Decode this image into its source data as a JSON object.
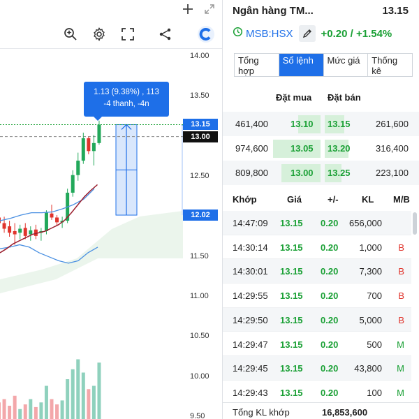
{
  "chart": {
    "tooltip_line1": "1.13 (9.38%) , 113",
    "tooltip_line2": "-4 thanh, -4n",
    "y_ticks": [
      "14.00",
      "13.50",
      "12.50",
      "11.50",
      "11.00",
      "10.50",
      "10.00",
      "9.50"
    ],
    "y_tick_values": [
      14.0,
      13.5,
      12.5,
      11.5,
      11.0,
      10.5,
      10.0,
      9.5
    ],
    "badge_current": "13.15",
    "badge_current_value": 13.15,
    "badge_prev": "13.00",
    "badge_prev_value": 13.0,
    "badge_low": "12.02",
    "badge_low_value": 12.02,
    "icons": [
      "plus-icon",
      "expand-icon",
      "magic-search-icon",
      "gear-icon",
      "fullscreen-icon",
      "share-icon",
      "brand-logo-icon"
    ]
  },
  "chart_data": {
    "type": "candlestick",
    "ylim": [
      9.4,
      14.1
    ],
    "candles": [
      {
        "o": 11.99,
        "h": 12.05,
        "l": 11.85,
        "c": 11.92
      },
      {
        "o": 11.92,
        "h": 12.0,
        "l": 11.8,
        "c": 11.85
      },
      {
        "o": 11.88,
        "h": 11.95,
        "l": 11.75,
        "c": 11.8
      },
      {
        "o": 11.82,
        "h": 11.92,
        "l": 11.65,
        "c": 11.78
      },
      {
        "o": 11.8,
        "h": 11.9,
        "l": 11.72,
        "c": 11.85
      },
      {
        "o": 11.86,
        "h": 11.92,
        "l": 11.72,
        "c": 11.76
      },
      {
        "o": 11.78,
        "h": 11.88,
        "l": 11.7,
        "c": 11.83
      },
      {
        "o": 11.84,
        "h": 11.9,
        "l": 11.72,
        "c": 11.76
      },
      {
        "o": 11.8,
        "h": 11.86,
        "l": 11.7,
        "c": 11.82
      },
      {
        "o": 11.82,
        "h": 12.08,
        "l": 11.78,
        "c": 12.05
      },
      {
        "o": 12.04,
        "h": 12.15,
        "l": 11.96,
        "c": 11.99
      },
      {
        "o": 11.99,
        "h": 12.02,
        "l": 11.88,
        "c": 11.93
      },
      {
        "o": 11.93,
        "h": 12.0,
        "l": 11.86,
        "c": 11.95
      },
      {
        "o": 11.95,
        "h": 12.35,
        "l": 11.92,
        "c": 12.3
      },
      {
        "o": 12.3,
        "h": 12.58,
        "l": 12.25,
        "c": 12.52
      },
      {
        "o": 12.52,
        "h": 12.8,
        "l": 12.45,
        "c": 12.7
      },
      {
        "o": 12.7,
        "h": 13.05,
        "l": 12.66,
        "c": 12.98
      },
      {
        "o": 12.98,
        "h": 13.0,
        "l": 12.78,
        "c": 12.82
      },
      {
        "o": 12.82,
        "h": 13.02,
        "l": 12.64,
        "c": 12.92
      },
      {
        "o": 12.92,
        "h": 13.2,
        "l": 12.9,
        "c": 13.15
      }
    ],
    "bollinger_upper": [
      11.95,
      11.98,
      12.02,
      12.05,
      12.05,
      12.06,
      12.1,
      12.15,
      12.22,
      12.35
    ],
    "bollinger_lower": [
      11.6,
      11.62,
      11.65,
      11.62,
      11.55,
      11.5,
      11.45,
      11.42,
      11.45,
      11.55,
      11.62
    ],
    "ma_line": [
      11.55,
      11.6,
      11.66,
      11.7,
      11.74,
      11.78,
      11.8,
      11.82,
      11.86,
      11.9,
      11.96,
      12.05,
      12.15,
      12.25,
      12.33,
      12.4
    ],
    "volume": [
      0.25,
      0.3,
      0.2,
      0.35,
      0.15,
      0.22,
      0.3,
      0.18,
      0.25,
      0.5,
      0.3,
      0.22,
      0.28,
      0.6,
      0.75,
      0.9,
      0.7,
      0.45,
      0.5,
      0.85
    ]
  },
  "panel": {
    "ticker_name": "Ngân hàng TM...",
    "ticker_price": "13.15",
    "symbol": "MSB:HSX",
    "change": "+0.20 / +1.54%",
    "tabs": [
      {
        "label": "Tổng hợp",
        "active": false
      },
      {
        "label": "Sổ lệnh",
        "active": true
      },
      {
        "label": "Mức giá",
        "active": false
      },
      {
        "label": "Thống kê",
        "active": false
      }
    ],
    "book_header": {
      "buy": "Đặt mua",
      "sell": "Đặt bán"
    },
    "book": [
      {
        "buy_vol": "461,400",
        "buy_px": "13.10",
        "sell_px": "13.15",
        "sell_vol": "261,600",
        "buy_frac": 0.4,
        "sell_frac": 0.35
      },
      {
        "buy_vol": "974,600",
        "buy_px": "13.05",
        "sell_px": "13.20",
        "sell_vol": "316,400",
        "buy_frac": 0.85,
        "sell_frac": 0.42
      },
      {
        "buy_vol": "809,800",
        "buy_px": "13.00",
        "sell_px": "13.25",
        "sell_vol": "223,100",
        "buy_frac": 0.7,
        "sell_frac": 0.3
      }
    ],
    "trades_header": {
      "time": "Khớp",
      "price": "Giá",
      "change": "+/-",
      "volume": "KL",
      "side": "M/B"
    },
    "trades": [
      {
        "time": "14:47:09",
        "price": "13.15",
        "change": "0.20",
        "volume": "656,000",
        "side": ""
      },
      {
        "time": "14:30:14",
        "price": "13.15",
        "change": "0.20",
        "volume": "1,000",
        "side": "B"
      },
      {
        "time": "14:30:01",
        "price": "13.15",
        "change": "0.20",
        "volume": "7,300",
        "side": "B"
      },
      {
        "time": "14:29:55",
        "price": "13.15",
        "change": "0.20",
        "volume": "700",
        "side": "B"
      },
      {
        "time": "14:29:50",
        "price": "13.15",
        "change": "0.20",
        "volume": "5,000",
        "side": "B"
      },
      {
        "time": "14:29:47",
        "price": "13.15",
        "change": "0.20",
        "volume": "500",
        "side": "M"
      },
      {
        "time": "14:29:45",
        "price": "13.15",
        "change": "0.20",
        "volume": "43,800",
        "side": "M"
      },
      {
        "time": "14:29:43",
        "price": "13.15",
        "change": "0.20",
        "volume": "100",
        "side": "M"
      }
    ],
    "footer_label": "Tổng KL khớp",
    "footer_value": "16,853,600",
    "colors": {
      "accent": "#1e6fe8",
      "up": "#1aa035",
      "down": "#e0342c",
      "buy_side": "#1aa035",
      "sell_side": "#e0342c"
    }
  }
}
